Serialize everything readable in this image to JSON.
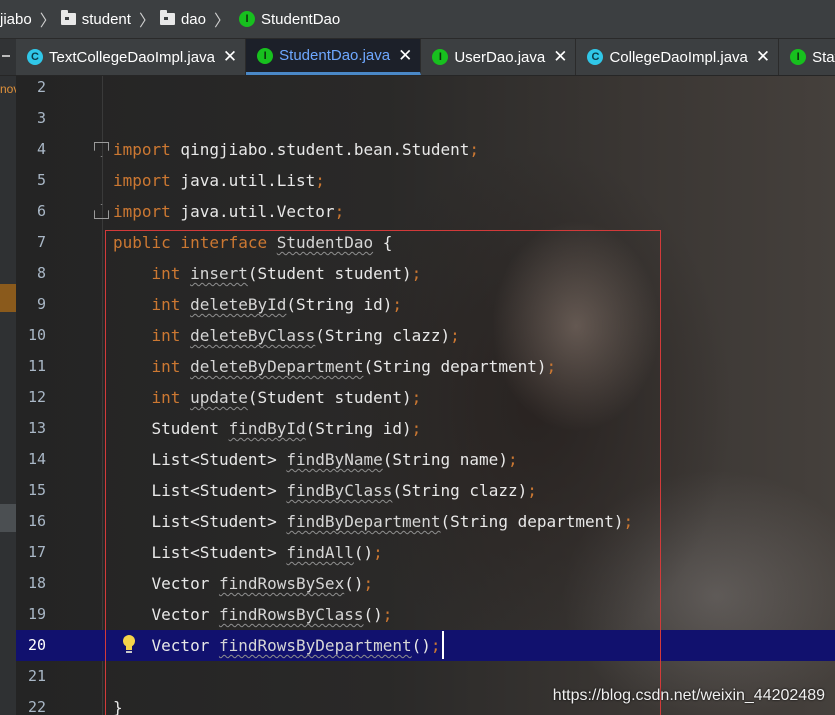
{
  "breadcrumb": {
    "items": [
      "jiabo",
      "student",
      "dao",
      "StudentDao"
    ]
  },
  "tabs": [
    {
      "label": "TextCollegeDaoImpl.java",
      "icon": "class-icon",
      "active": false
    },
    {
      "label": "StudentDao.java",
      "icon": "interface-icon",
      "active": true
    },
    {
      "label": "UserDao.java",
      "icon": "interface-icon",
      "active": false
    },
    {
      "label": "CollegeDaoImpl.java",
      "icon": "class-icon",
      "active": false
    },
    {
      "label": "StatusD",
      "icon": "interface-icon",
      "active": false
    }
  ],
  "tab_close_glyph": "✕",
  "icon_letters": {
    "class": "C",
    "interface": "I"
  },
  "left_strip_text": "nov",
  "editor": {
    "current_line": 20,
    "lines": [
      {
        "n": "2",
        "tokens": []
      },
      {
        "n": "3",
        "tokens": []
      },
      {
        "n": "4",
        "fold": "open",
        "tokens": [
          [
            "kw",
            "import"
          ],
          [
            "plain",
            " qingjiabo.student.bean.Student"
          ],
          [
            "punct",
            ";"
          ]
        ]
      },
      {
        "n": "5",
        "tokens": [
          [
            "kw",
            "import"
          ],
          [
            "plain",
            " java.util.List"
          ],
          [
            "punct",
            ";"
          ]
        ]
      },
      {
        "n": "6",
        "fold": "close",
        "tokens": [
          [
            "kw",
            "import"
          ],
          [
            "plain",
            " java.util.Vector"
          ],
          [
            "punct",
            ";"
          ]
        ]
      },
      {
        "n": "7",
        "tokens": [
          [
            "kw",
            "public interface "
          ],
          [
            "name",
            "StudentDao"
          ],
          [
            "plain",
            " {"
          ]
        ]
      },
      {
        "n": "8",
        "tokens": [
          [
            "plain",
            "    "
          ],
          [
            "kw",
            "int "
          ],
          [
            "name",
            "insert"
          ],
          [
            "plain",
            "(Student student)"
          ],
          [
            "punct",
            ";"
          ]
        ]
      },
      {
        "n": "9",
        "tokens": [
          [
            "plain",
            "    "
          ],
          [
            "kw",
            "int "
          ],
          [
            "name",
            "deleteById"
          ],
          [
            "plain",
            "(String id)"
          ],
          [
            "punct",
            ";"
          ]
        ]
      },
      {
        "n": "10",
        "tokens": [
          [
            "plain",
            "    "
          ],
          [
            "kw",
            "int "
          ],
          [
            "name",
            "deleteByClass"
          ],
          [
            "plain",
            "(String clazz)"
          ],
          [
            "punct",
            ";"
          ]
        ]
      },
      {
        "n": "11",
        "tokens": [
          [
            "plain",
            "    "
          ],
          [
            "kw",
            "int "
          ],
          [
            "name",
            "deleteByDepartment"
          ],
          [
            "plain",
            "(String department)"
          ],
          [
            "punct",
            ";"
          ]
        ]
      },
      {
        "n": "12",
        "tokens": [
          [
            "plain",
            "    "
          ],
          [
            "kw",
            "int "
          ],
          [
            "name",
            "update"
          ],
          [
            "plain",
            "(Student student)"
          ],
          [
            "punct",
            ";"
          ]
        ]
      },
      {
        "n": "13",
        "tokens": [
          [
            "plain",
            "    Student "
          ],
          [
            "name",
            "findById"
          ],
          [
            "plain",
            "(String id)"
          ],
          [
            "punct",
            ";"
          ]
        ]
      },
      {
        "n": "14",
        "tokens": [
          [
            "plain",
            "    List<Student> "
          ],
          [
            "name",
            "findByName"
          ],
          [
            "plain",
            "(String name)"
          ],
          [
            "punct",
            ";"
          ]
        ]
      },
      {
        "n": "15",
        "tokens": [
          [
            "plain",
            "    List<Student> "
          ],
          [
            "name",
            "findByClass"
          ],
          [
            "plain",
            "(String clazz)"
          ],
          [
            "punct",
            ";"
          ]
        ]
      },
      {
        "n": "16",
        "tokens": [
          [
            "plain",
            "    List<Student> "
          ],
          [
            "name",
            "findByDepartment"
          ],
          [
            "plain",
            "(String department)"
          ],
          [
            "punct",
            ";"
          ]
        ]
      },
      {
        "n": "17",
        "tokens": [
          [
            "plain",
            "    List<Student> "
          ],
          [
            "name",
            "findAll"
          ],
          [
            "plain",
            "()"
          ],
          [
            "punct",
            ";"
          ]
        ]
      },
      {
        "n": "18",
        "tokens": [
          [
            "plain",
            "    Vector "
          ],
          [
            "name",
            "findRowsBySex"
          ],
          [
            "plain",
            "()"
          ],
          [
            "punct",
            ";"
          ]
        ]
      },
      {
        "n": "19",
        "tokens": [
          [
            "plain",
            "    Vector "
          ],
          [
            "name",
            "findRowsByClass"
          ],
          [
            "plain",
            "()"
          ],
          [
            "punct",
            ";"
          ]
        ]
      },
      {
        "n": "20",
        "tokens": [
          [
            "plain",
            "    Vector "
          ],
          [
            "name",
            "findRowsByDepartment"
          ],
          [
            "plain",
            "()"
          ],
          [
            "punct",
            ";"
          ]
        ]
      },
      {
        "n": "21",
        "tokens": []
      },
      {
        "n": "22",
        "tokens": [
          [
            "plain",
            "}"
          ]
        ]
      }
    ]
  },
  "watermark": "https://blog.csdn.net/weixin_44202489",
  "colors": {
    "keyword": "#cc7832",
    "current_line": "#11116e",
    "highlight_box": "#d23a3a",
    "active_tab_text": "#6ea8ff",
    "interface_icon": "#17c01e",
    "class_icon": "#30c7e8"
  }
}
